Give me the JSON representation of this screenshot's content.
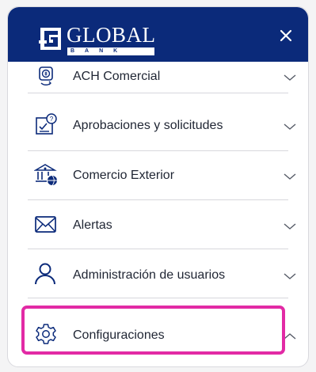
{
  "header": {
    "logo_text": "GLOBAL",
    "logo_subtext": "BANK",
    "close_label": "×"
  },
  "menu": {
    "items": [
      {
        "label": "ACH Comercial",
        "icon": "money-transfer-icon",
        "expanded": false
      },
      {
        "label": "Aprobaciones y solicitudes",
        "icon": "approval-document-icon",
        "expanded": false
      },
      {
        "label": "Comercio Exterior",
        "icon": "bank-globe-icon",
        "expanded": false
      },
      {
        "label": "Alertas",
        "icon": "envelope-icon",
        "expanded": false
      },
      {
        "label": "Administración de usuarios",
        "icon": "user-icon",
        "expanded": false
      },
      {
        "label": "Configuraciones",
        "icon": "gear-icon",
        "expanded": true
      }
    ]
  },
  "colors": {
    "header_bg": "#0b2a7a",
    "highlight": "#e22aa5",
    "icon_color": "#0b2a7a"
  }
}
